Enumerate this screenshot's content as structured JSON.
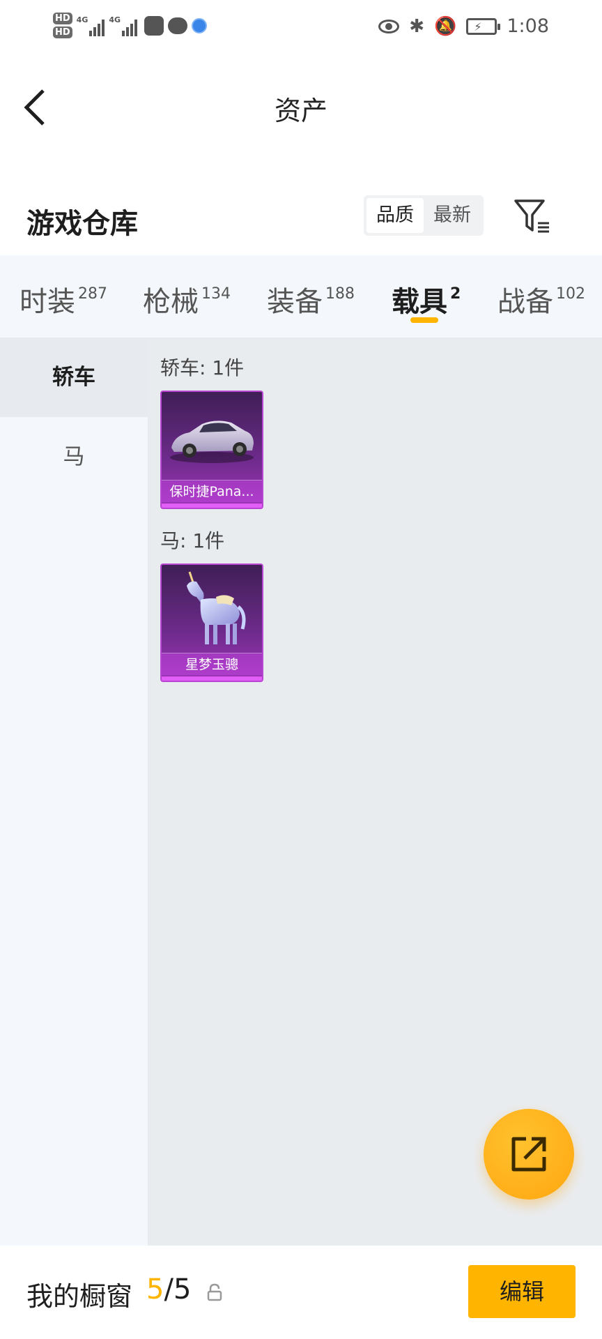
{
  "status_bar": {
    "network_1": "HD",
    "network_2": "HD",
    "sim_1_type": "4G",
    "sim_2_type": "4G",
    "time": "1:08",
    "icons": [
      "eye-icon",
      "bluetooth-icon",
      "mute-bell-icon",
      "battery-charging-icon"
    ]
  },
  "header": {
    "title": "资产",
    "back_icon": "chevron-left-icon"
  },
  "warehouse": {
    "title": "游戏仓库",
    "sort_options": [
      "品质",
      "最新"
    ],
    "sort_selected": "品质",
    "filter_icon": "filter-icon"
  },
  "tabs": [
    {
      "label": "时装",
      "count": "287"
    },
    {
      "label": "枪械",
      "count": "134"
    },
    {
      "label": "装备",
      "count": "188"
    },
    {
      "label": "载具",
      "count": "2"
    },
    {
      "label": "战备",
      "count": "102"
    }
  ],
  "active_tab": "载具",
  "sidebar": {
    "items": [
      {
        "label": "轿车"
      },
      {
        "label": "马"
      }
    ],
    "active": "轿车"
  },
  "groups": [
    {
      "title": "轿车: 1件",
      "items": [
        {
          "name": "保时捷Pana..."
        }
      ]
    },
    {
      "title": "马: 1件",
      "items": [
        {
          "name": "星梦玉骢"
        }
      ]
    }
  ],
  "fab": {
    "icon": "share-external-icon"
  },
  "bottom_bar": {
    "showcase_label": "我的橱窗",
    "showcase_current": "5",
    "showcase_separator": "/",
    "showcase_total": "5",
    "lock_icon": "lock-icon",
    "edit_label": "编辑"
  },
  "colors": {
    "accent": "#ffb400",
    "card_purple": "#6a2a88",
    "content_bg": "#e9ecef"
  }
}
